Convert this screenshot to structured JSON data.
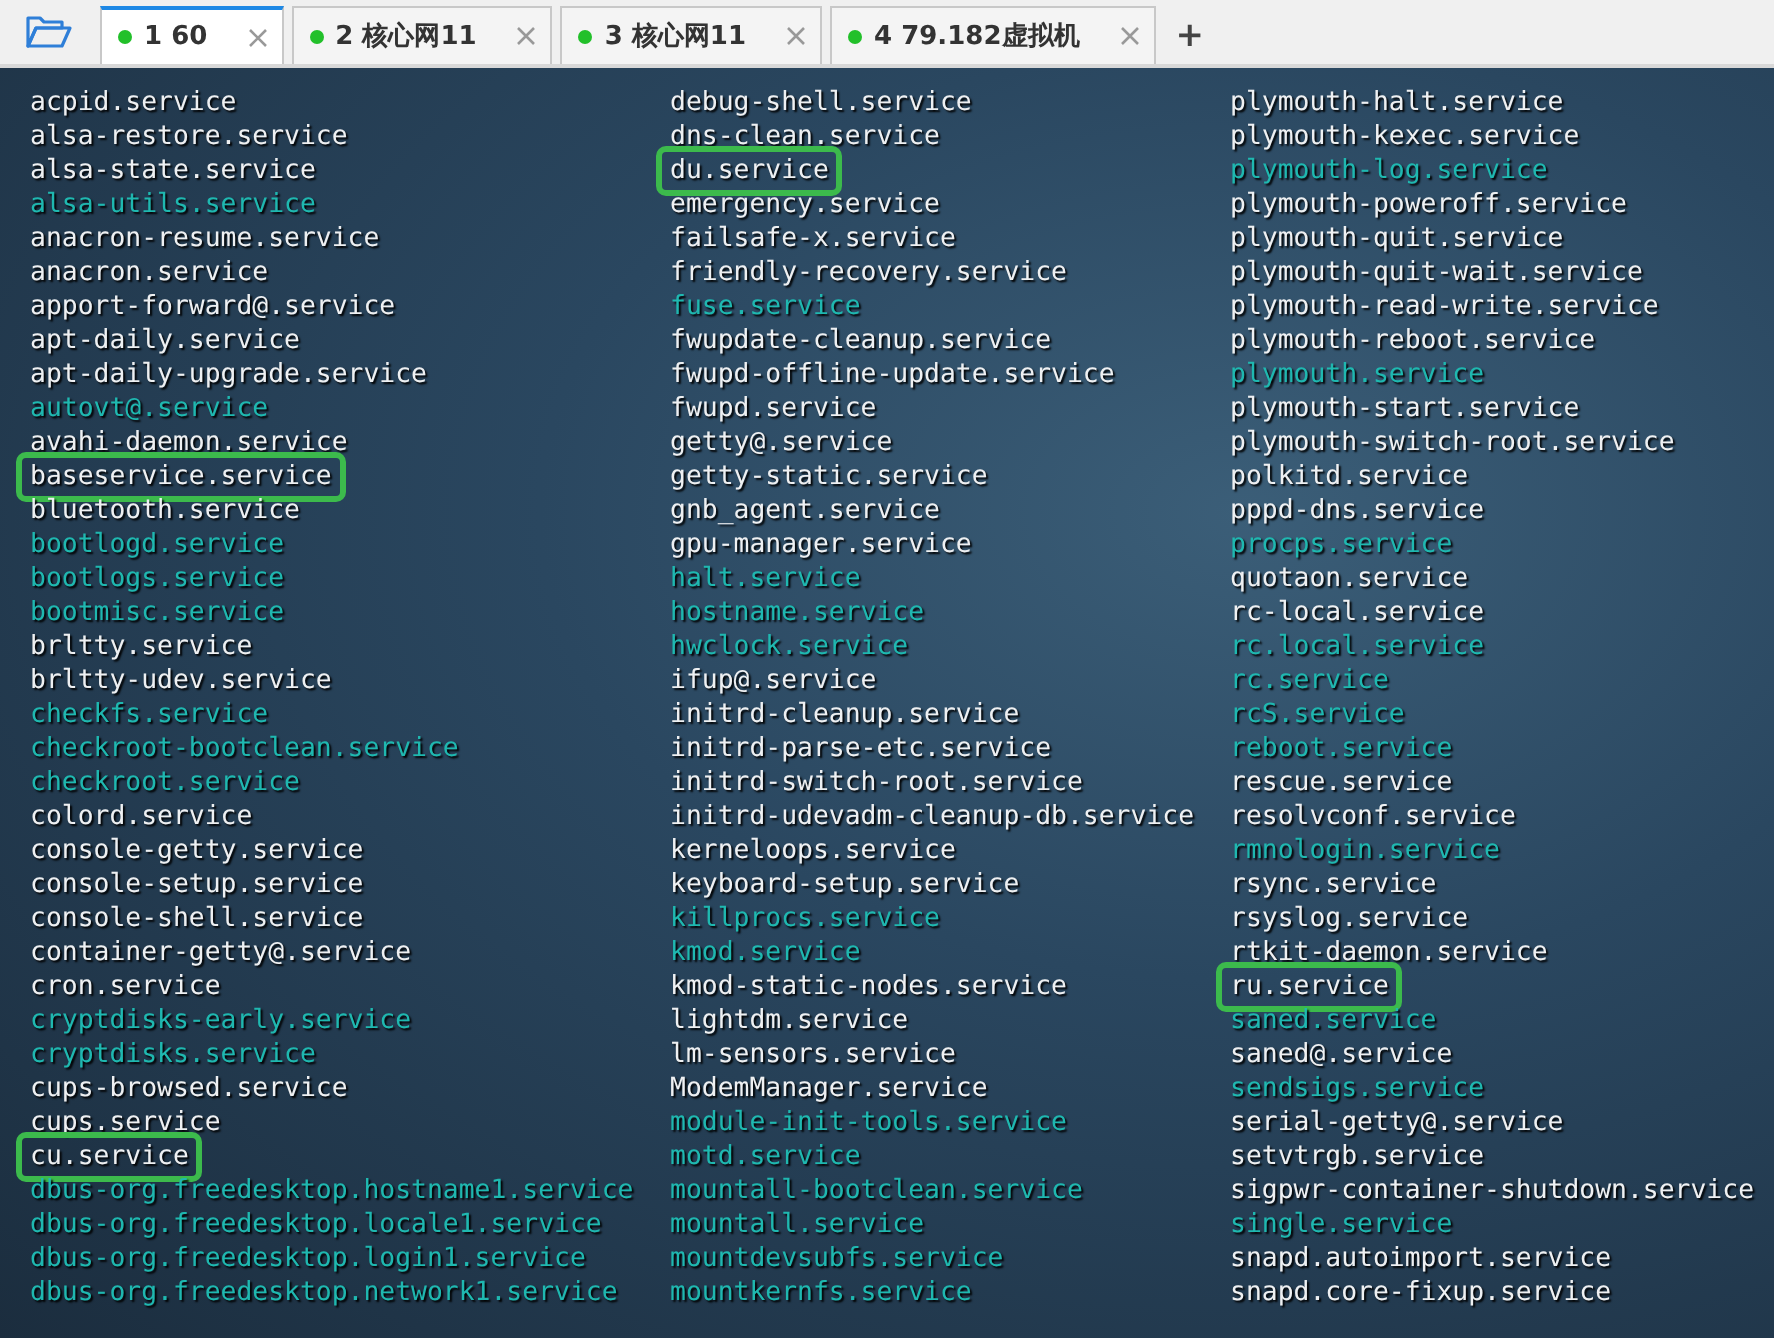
{
  "tabs": [
    {
      "label": "1 60",
      "selected": true,
      "connected": true
    },
    {
      "label": "2 核心网11",
      "selected": false,
      "connected": true
    },
    {
      "label": "3 核心网11",
      "selected": false,
      "connected": true
    },
    {
      "label": "4 79.182虚拟机",
      "selected": false,
      "connected": true
    }
  ],
  "new_tab": "+",
  "columns": [
    {
      "items": [
        {
          "name": "acpid.service",
          "kind": "file",
          "highlighted": false
        },
        {
          "name": "alsa-restore.service",
          "kind": "file",
          "highlighted": false
        },
        {
          "name": "alsa-state.service",
          "kind": "file",
          "highlighted": false
        },
        {
          "name": "alsa-utils.service",
          "kind": "link",
          "highlighted": false
        },
        {
          "name": "anacron-resume.service",
          "kind": "file",
          "highlighted": false
        },
        {
          "name": "anacron.service",
          "kind": "file",
          "highlighted": false
        },
        {
          "name": "apport-forward@.service",
          "kind": "file",
          "highlighted": false
        },
        {
          "name": "apt-daily.service",
          "kind": "file",
          "highlighted": false
        },
        {
          "name": "apt-daily-upgrade.service",
          "kind": "file",
          "highlighted": false
        },
        {
          "name": "autovt@.service",
          "kind": "link",
          "highlighted": false
        },
        {
          "name": "avahi-daemon.service",
          "kind": "file",
          "highlighted": false
        },
        {
          "name": "baseservice.service",
          "kind": "file",
          "highlighted": true
        },
        {
          "name": "bluetooth.service",
          "kind": "file",
          "highlighted": false
        },
        {
          "name": "bootlogd.service",
          "kind": "link",
          "highlighted": false
        },
        {
          "name": "bootlogs.service",
          "kind": "link",
          "highlighted": false
        },
        {
          "name": "bootmisc.service",
          "kind": "link",
          "highlighted": false
        },
        {
          "name": "brltty.service",
          "kind": "file",
          "highlighted": false
        },
        {
          "name": "brltty-udev.service",
          "kind": "file",
          "highlighted": false
        },
        {
          "name": "checkfs.service",
          "kind": "link",
          "highlighted": false
        },
        {
          "name": "checkroot-bootclean.service",
          "kind": "link",
          "highlighted": false
        },
        {
          "name": "checkroot.service",
          "kind": "link",
          "highlighted": false
        },
        {
          "name": "colord.service",
          "kind": "file",
          "highlighted": false
        },
        {
          "name": "console-getty.service",
          "kind": "file",
          "highlighted": false
        },
        {
          "name": "console-setup.service",
          "kind": "file",
          "highlighted": false
        },
        {
          "name": "console-shell.service",
          "kind": "file",
          "highlighted": false
        },
        {
          "name": "container-getty@.service",
          "kind": "file",
          "highlighted": false
        },
        {
          "name": "cron.service",
          "kind": "file",
          "highlighted": false
        },
        {
          "name": "cryptdisks-early.service",
          "kind": "link",
          "highlighted": false
        },
        {
          "name": "cryptdisks.service",
          "kind": "link",
          "highlighted": false
        },
        {
          "name": "cups-browsed.service",
          "kind": "file",
          "highlighted": false
        },
        {
          "name": "cups.service",
          "kind": "file",
          "highlighted": false
        },
        {
          "name": "cu.service",
          "kind": "file",
          "highlighted": true
        },
        {
          "name": "dbus-org.freedesktop.hostname1.service",
          "kind": "link",
          "highlighted": false
        },
        {
          "name": "dbus-org.freedesktop.locale1.service",
          "kind": "link",
          "highlighted": false
        },
        {
          "name": "dbus-org.freedesktop.login1.service",
          "kind": "link",
          "highlighted": false
        },
        {
          "name": "dbus-org.freedesktop.network1.service",
          "kind": "link",
          "highlighted": false
        }
      ]
    },
    {
      "items": [
        {
          "name": "debug-shell.service",
          "kind": "file",
          "highlighted": false
        },
        {
          "name": "dns-clean.service",
          "kind": "file",
          "highlighted": false
        },
        {
          "name": "du.service",
          "kind": "file",
          "highlighted": true
        },
        {
          "name": "emergency.service",
          "kind": "file",
          "highlighted": false
        },
        {
          "name": "failsafe-x.service",
          "kind": "file",
          "highlighted": false
        },
        {
          "name": "friendly-recovery.service",
          "kind": "file",
          "highlighted": false
        },
        {
          "name": "fuse.service",
          "kind": "link",
          "highlighted": false
        },
        {
          "name": "fwupdate-cleanup.service",
          "kind": "file",
          "highlighted": false
        },
        {
          "name": "fwupd-offline-update.service",
          "kind": "file",
          "highlighted": false
        },
        {
          "name": "fwupd.service",
          "kind": "file",
          "highlighted": false
        },
        {
          "name": "getty@.service",
          "kind": "file",
          "highlighted": false
        },
        {
          "name": "getty-static.service",
          "kind": "file",
          "highlighted": false
        },
        {
          "name": "gnb_agent.service",
          "kind": "file",
          "highlighted": false
        },
        {
          "name": "gpu-manager.service",
          "kind": "file",
          "highlighted": false
        },
        {
          "name": "halt.service",
          "kind": "link",
          "highlighted": false
        },
        {
          "name": "hostname.service",
          "kind": "link",
          "highlighted": false
        },
        {
          "name": "hwclock.service",
          "kind": "link",
          "highlighted": false
        },
        {
          "name": "ifup@.service",
          "kind": "file",
          "highlighted": false
        },
        {
          "name": "initrd-cleanup.service",
          "kind": "file",
          "highlighted": false
        },
        {
          "name": "initrd-parse-etc.service",
          "kind": "file",
          "highlighted": false
        },
        {
          "name": "initrd-switch-root.service",
          "kind": "file",
          "highlighted": false
        },
        {
          "name": "initrd-udevadm-cleanup-db.service",
          "kind": "file",
          "highlighted": false
        },
        {
          "name": "kerneloops.service",
          "kind": "file",
          "highlighted": false
        },
        {
          "name": "keyboard-setup.service",
          "kind": "file",
          "highlighted": false
        },
        {
          "name": "killprocs.service",
          "kind": "link",
          "highlighted": false
        },
        {
          "name": "kmod.service",
          "kind": "link",
          "highlighted": false
        },
        {
          "name": "kmod-static-nodes.service",
          "kind": "file",
          "highlighted": false
        },
        {
          "name": "lightdm.service",
          "kind": "file",
          "highlighted": false
        },
        {
          "name": "lm-sensors.service",
          "kind": "file",
          "highlighted": false
        },
        {
          "name": "ModemManager.service",
          "kind": "file",
          "highlighted": false
        },
        {
          "name": "module-init-tools.service",
          "kind": "link",
          "highlighted": false
        },
        {
          "name": "motd.service",
          "kind": "link",
          "highlighted": false
        },
        {
          "name": "mountall-bootclean.service",
          "kind": "link",
          "highlighted": false
        },
        {
          "name": "mountall.service",
          "kind": "link",
          "highlighted": false
        },
        {
          "name": "mountdevsubfs.service",
          "kind": "link",
          "highlighted": false
        },
        {
          "name": "mountkernfs.service",
          "kind": "link",
          "highlighted": false
        }
      ]
    },
    {
      "items": [
        {
          "name": "plymouth-halt.service",
          "kind": "file",
          "highlighted": false
        },
        {
          "name": "plymouth-kexec.service",
          "kind": "file",
          "highlighted": false
        },
        {
          "name": "plymouth-log.service",
          "kind": "link",
          "highlighted": false
        },
        {
          "name": "plymouth-poweroff.service",
          "kind": "file",
          "highlighted": false
        },
        {
          "name": "plymouth-quit.service",
          "kind": "file",
          "highlighted": false
        },
        {
          "name": "plymouth-quit-wait.service",
          "kind": "file",
          "highlighted": false
        },
        {
          "name": "plymouth-read-write.service",
          "kind": "file",
          "highlighted": false
        },
        {
          "name": "plymouth-reboot.service",
          "kind": "file",
          "highlighted": false
        },
        {
          "name": "plymouth.service",
          "kind": "link",
          "highlighted": false
        },
        {
          "name": "plymouth-start.service",
          "kind": "file",
          "highlighted": false
        },
        {
          "name": "plymouth-switch-root.service",
          "kind": "file",
          "highlighted": false
        },
        {
          "name": "polkitd.service",
          "kind": "file",
          "highlighted": false
        },
        {
          "name": "pppd-dns.service",
          "kind": "file",
          "highlighted": false
        },
        {
          "name": "procps.service",
          "kind": "link",
          "highlighted": false
        },
        {
          "name": "quotaon.service",
          "kind": "file",
          "highlighted": false
        },
        {
          "name": "rc-local.service",
          "kind": "file",
          "highlighted": false
        },
        {
          "name": "rc.local.service",
          "kind": "link",
          "highlighted": false
        },
        {
          "name": "rc.service",
          "kind": "link",
          "highlighted": false
        },
        {
          "name": "rcS.service",
          "kind": "link",
          "highlighted": false
        },
        {
          "name": "reboot.service",
          "kind": "link",
          "highlighted": false
        },
        {
          "name": "rescue.service",
          "kind": "file",
          "highlighted": false
        },
        {
          "name": "resolvconf.service",
          "kind": "file",
          "highlighted": false
        },
        {
          "name": "rmnologin.service",
          "kind": "link",
          "highlighted": false
        },
        {
          "name": "rsync.service",
          "kind": "file",
          "highlighted": false
        },
        {
          "name": "rsyslog.service",
          "kind": "file",
          "highlighted": false
        },
        {
          "name": "rtkit-daemon.service",
          "kind": "file",
          "highlighted": false
        },
        {
          "name": "ru.service",
          "kind": "file",
          "highlighted": true
        },
        {
          "name": "saned.service",
          "kind": "link",
          "highlighted": false
        },
        {
          "name": "saned@.service",
          "kind": "file",
          "highlighted": false
        },
        {
          "name": "sendsigs.service",
          "kind": "link",
          "highlighted": false
        },
        {
          "name": "serial-getty@.service",
          "kind": "file",
          "highlighted": false
        },
        {
          "name": "setvtrgb.service",
          "kind": "file",
          "highlighted": false
        },
        {
          "name": "sigpwr-container-shutdown.service",
          "kind": "file",
          "highlighted": false
        },
        {
          "name": "single.service",
          "kind": "link",
          "highlighted": false
        },
        {
          "name": "snapd.autoimport.service",
          "kind": "file",
          "highlighted": false
        },
        {
          "name": "snapd.core-fixup.service",
          "kind": "file",
          "highlighted": false
        }
      ]
    }
  ]
}
